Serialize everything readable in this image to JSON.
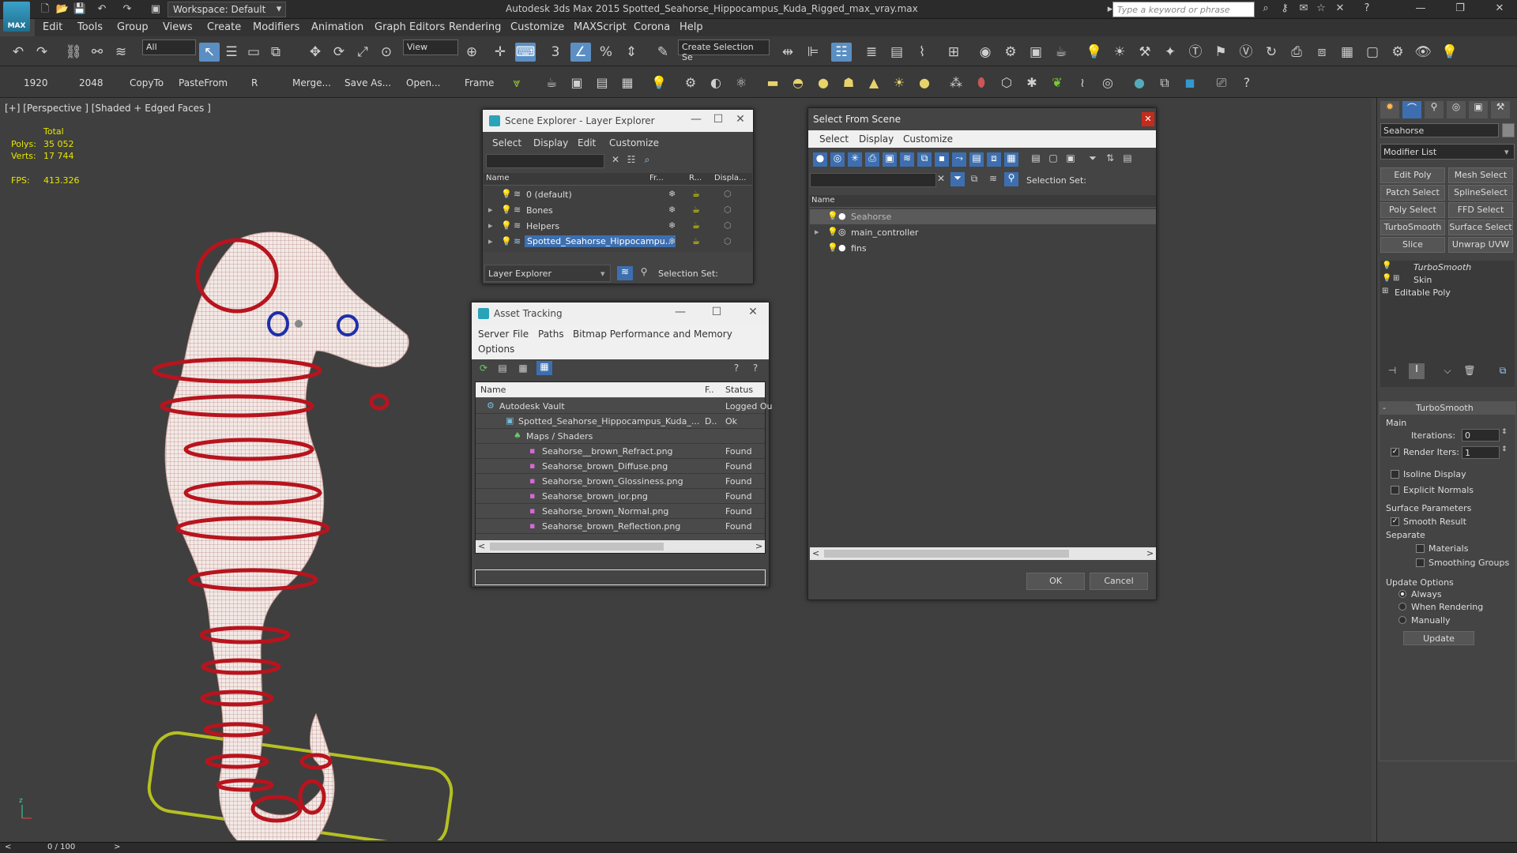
{
  "window": {
    "title": "Autodesk 3ds Max  2015    Spotted_Seahorse_Hippocampus_Kuda_Rigged_max_vray.max",
    "logo_text": "MAX",
    "workspace": "Workspace: Default",
    "search_placeholder": "Type a keyword or phrase"
  },
  "menu": [
    "Edit",
    "Tools",
    "Group",
    "Views",
    "Create",
    "Modifiers",
    "Animation",
    "Graph Editors",
    "Rendering",
    "Customize",
    "MAXScript",
    "Corona",
    "Help"
  ],
  "toolbar": {
    "selection_filter": "All",
    "ref_coord": "View",
    "named_selection": "Create Selection Se"
  },
  "toolbar2": {
    "labels": [
      "1920",
      "2048",
      "CopyTo",
      "PasteFrom",
      "R",
      "Merge...",
      "Save As...",
      "Open...",
      "Frame"
    ]
  },
  "viewport": {
    "label": "[+] [Perspective ] [Shaded + Edged Faces ]",
    "stats_total": "Total",
    "polys_label": "Polys:",
    "polys_value": "35 052",
    "verts_label": "Verts:",
    "verts_value": "17 744",
    "fps_label": "FPS:",
    "fps_value": "413.326"
  },
  "status": {
    "frame": "0 / 100"
  },
  "scene_explorer": {
    "title": "Scene Explorer - Layer Explorer",
    "menu": [
      "Select",
      "Display",
      "Edit",
      "Customize"
    ],
    "columns": [
      "Name",
      "Fr...",
      "R...",
      "Displa..."
    ],
    "rows": [
      "0 (default)",
      "Bones",
      "Helpers",
      "Spotted_Seahorse_Hippocampu..."
    ],
    "footer_combo": "Layer Explorer",
    "footer_label": "Selection Set:"
  },
  "asset_tracking": {
    "title": "Asset Tracking",
    "menu": [
      "Server",
      "File",
      "Paths",
      "Bitmap Performance and Memory",
      "Options"
    ],
    "columns": [
      "Name",
      "F..",
      "Status"
    ],
    "rows": [
      {
        "name": "Autodesk Vault",
        "f": "",
        "status": "Logged Ou"
      },
      {
        "name": "Spotted_Seahorse_Hippocampus_Kuda_...",
        "f": "D..",
        "status": "Ok"
      },
      {
        "name": "Maps / Shaders",
        "f": "",
        "status": ""
      },
      {
        "name": "Seahorse__brown_Refract.png",
        "f": "",
        "status": "Found"
      },
      {
        "name": "Seahorse_brown_Diffuse.png",
        "f": "",
        "status": "Found"
      },
      {
        "name": "Seahorse_brown_Glossiness.png",
        "f": "",
        "status": "Found"
      },
      {
        "name": "Seahorse_brown_ior.png",
        "f": "",
        "status": "Found"
      },
      {
        "name": "Seahorse_brown_Normal.png",
        "f": "",
        "status": "Found"
      },
      {
        "name": "Seahorse_brown_Reflection.png",
        "f": "",
        "status": "Found"
      }
    ]
  },
  "select_from_scene": {
    "title": "Select From Scene",
    "menu": [
      "Select",
      "Display",
      "Customize"
    ],
    "selection_set_label": "Selection Set:",
    "column": "Name",
    "rows": [
      "Seahorse",
      "main_controller",
      "fins"
    ],
    "ok": "OK",
    "cancel": "Cancel"
  },
  "command_panel": {
    "object_name": "Seahorse",
    "modifier_list": "Modifier List",
    "buttons": [
      "Edit Poly",
      "Mesh Select",
      "Patch Select",
      "SplineSelect",
      "Poly Select",
      "FFD Select",
      "TurboSmooth",
      "Surface Select",
      "Slice",
      "Unwrap UVW"
    ],
    "stack": [
      "TurboSmooth",
      "Skin",
      "Editable Poly"
    ],
    "rollout_title": "TurboSmooth",
    "main_label": "Main",
    "iterations_label": "Iterations:",
    "iterations_value": "0",
    "render_iters_label": "Render Iters:",
    "render_iters_value": "1",
    "isoline": "Isoline Display",
    "explicit_normals": "Explicit Normals",
    "surface_params": "Surface Parameters",
    "smooth_result": "Smooth Result",
    "separate": "Separate",
    "materials": "Materials",
    "smoothing_groups": "Smoothing Groups",
    "update_options": "Update Options",
    "always": "Always",
    "when_rendering": "When Rendering",
    "manually": "Manually",
    "update_btn": "Update"
  },
  "colors": {
    "accent": "#5b8fc4",
    "selection": "#3d6fb0",
    "mesh": "#f1e6e3",
    "rig": "#b8141e",
    "ground": "#b5c022"
  }
}
